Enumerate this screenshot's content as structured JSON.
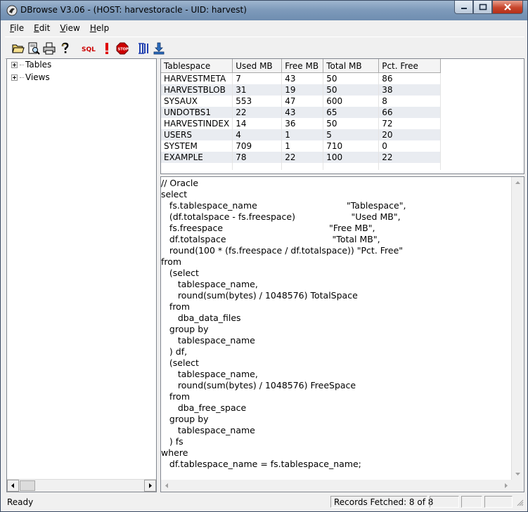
{
  "window": {
    "title": "DBrowse V3.06 - (HOST: harvestoracle -   UID: harvest)"
  },
  "menu": [
    {
      "label": "File",
      "accel": "F",
      "rest": "ile"
    },
    {
      "label": "Edit",
      "accel": "E",
      "rest": "dit"
    },
    {
      "label": "View",
      "accel": "V",
      "rest": "iew"
    },
    {
      "label": "Help",
      "accel": "H",
      "rest": "elp"
    }
  ],
  "toolbar": {
    "sql_label": "SQL",
    "stop_label": "STOP",
    "colors": {
      "sql": "#cc0000",
      "bang": "#e00000",
      "stop": "#cc0000",
      "columns": "#1f3fb0",
      "export": "#2d6fbf"
    }
  },
  "tree": {
    "items": [
      {
        "label": "Tables"
      },
      {
        "label": "Views"
      }
    ]
  },
  "grid": {
    "columns": [
      "Tablespace",
      "Used MB",
      "Free MB",
      "Total MB",
      "Pct. Free"
    ],
    "rows": [
      [
        "HARVESTMETA",
        "7",
        "43",
        "50",
        "86"
      ],
      [
        "HARVESTBLOB",
        "31",
        "19",
        "50",
        "38"
      ],
      [
        "SYSAUX",
        "553",
        "47",
        "600",
        "8"
      ],
      [
        "UNDOTBS1",
        "22",
        "43",
        "65",
        "66"
      ],
      [
        "HARVESTINDEX",
        "14",
        "36",
        "50",
        "72"
      ],
      [
        "USERS",
        "4",
        "1",
        "5",
        "20"
      ],
      [
        "SYSTEM",
        "709",
        "1",
        "710",
        "0"
      ],
      [
        "EXAMPLE",
        "78",
        "22",
        "100",
        "22"
      ]
    ]
  },
  "editor": {
    "text": "// Oracle\nselect\n   fs.tablespace_name                                \"Tablespace\",\n   (df.totalspace - fs.freespace)                    \"Used MB\",\n   fs.freespace                                      \"Free MB\",\n   df.totalspace                                      \"Total MB\",\n   round(100 * (fs.freespace / df.totalspace)) \"Pct. Free\"\nfrom\n   (select\n      tablespace_name,\n      round(sum(bytes) / 1048576) TotalSpace\n   from\n      dba_data_files\n   group by\n      tablespace_name\n   ) df,\n   (select\n      tablespace_name,\n      round(sum(bytes) / 1048576) FreeSpace\n   from\n      dba_free_space\n   group by\n      tablespace_name\n   ) fs\nwhere\n   df.tablespace_name = fs.tablespace_name;"
  },
  "status": {
    "ready": "Ready",
    "records": "Records Fetched: 8  of  8"
  }
}
